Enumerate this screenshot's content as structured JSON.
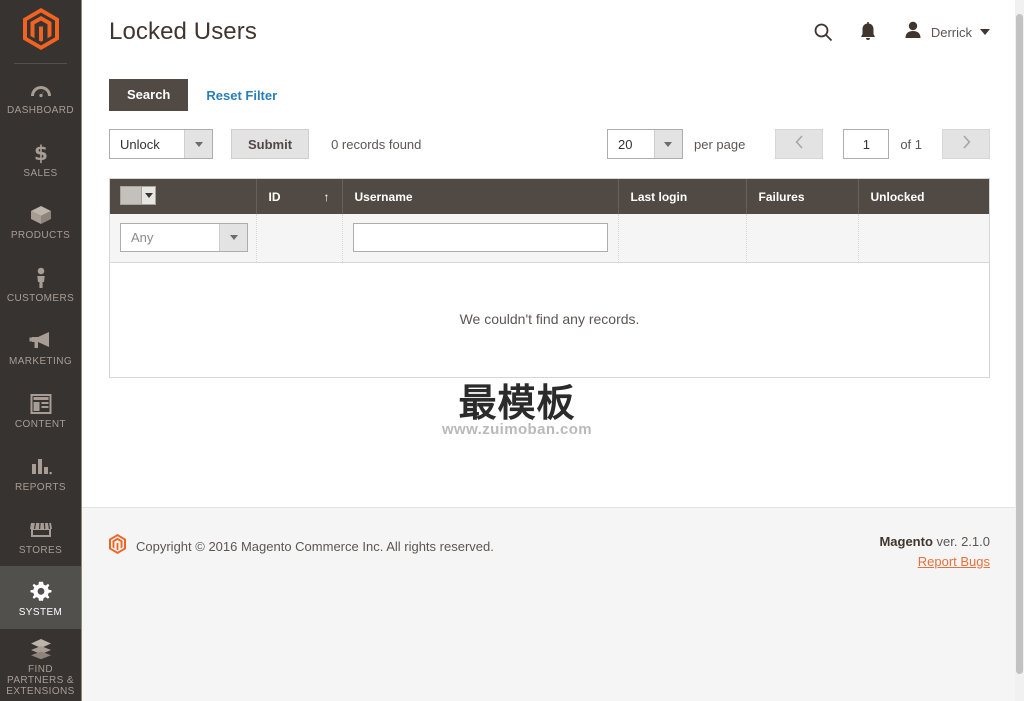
{
  "sidebar": {
    "logo": "magento-logo",
    "items": [
      {
        "label": "DASHBOARD",
        "icon": "dashboard-icon",
        "active": false
      },
      {
        "label": "SALES",
        "icon": "dollar-icon",
        "active": false
      },
      {
        "label": "PRODUCTS",
        "icon": "box-icon",
        "active": false
      },
      {
        "label": "CUSTOMERS",
        "icon": "person-icon",
        "active": false
      },
      {
        "label": "MARKETING",
        "icon": "megaphone-icon",
        "active": false
      },
      {
        "label": "CONTENT",
        "icon": "layout-icon",
        "active": false
      },
      {
        "label": "REPORTS",
        "icon": "bar-chart-icon",
        "active": false
      },
      {
        "label": "STORES",
        "icon": "storefront-icon",
        "active": false
      },
      {
        "label": "SYSTEM",
        "icon": "gear-icon",
        "active": true
      },
      {
        "label": "FIND PARTNERS & EXTENSIONS",
        "icon": "extensions-icon",
        "active": false
      }
    ]
  },
  "header": {
    "title": "Locked Users",
    "search_icon": "search-icon",
    "notifications_icon": "bell-icon",
    "account_icon": "user-avatar-icon",
    "account_name": "Derrick",
    "caret_icon": "chevron-down-icon"
  },
  "toolbar": {
    "search_label": "Search",
    "reset_filter_label": "Reset Filter",
    "massaction_value": "Unlock",
    "submit_label": "Submit",
    "records_found": "0 records found"
  },
  "pager": {
    "per_page_value": "20",
    "per_page_label": "per page",
    "prev_icon": "chevron-left-icon",
    "next_icon": "chevron-right-icon",
    "current_page": "1",
    "of_label": "of 1"
  },
  "grid": {
    "select_all_icon": "checkbox-dropdown-icon",
    "columns": [
      {
        "label": "",
        "name": "select"
      },
      {
        "label": "ID",
        "name": "id",
        "sorted": "asc",
        "sort_icon": "↑"
      },
      {
        "label": "Username",
        "name": "username"
      },
      {
        "label": "Last login",
        "name": "last-login"
      },
      {
        "label": "Failures",
        "name": "failures"
      },
      {
        "label": "Unlocked",
        "name": "unlocked"
      }
    ],
    "filters": {
      "select_value": "Any",
      "username_value": "",
      "username_placeholder": ""
    },
    "empty_message": "We couldn't find any records.",
    "rows": []
  },
  "watermark": {
    "text": "最模板",
    "url": "www.zuimoban.com"
  },
  "footer": {
    "logo": "magento-footer-logo",
    "copyright": "Copyright © 2016 Magento Commerce Inc. All rights reserved.",
    "version_brand": "Magento",
    "version_text": " ver. 2.1.0",
    "report_bugs": "Report Bugs"
  },
  "colors": {
    "sidebar_bg": "#373330",
    "sidebar_active": "#52504d",
    "accent_orange": "#e8713e",
    "header_dark": "#514943",
    "link_blue": "#2a7ebb"
  }
}
